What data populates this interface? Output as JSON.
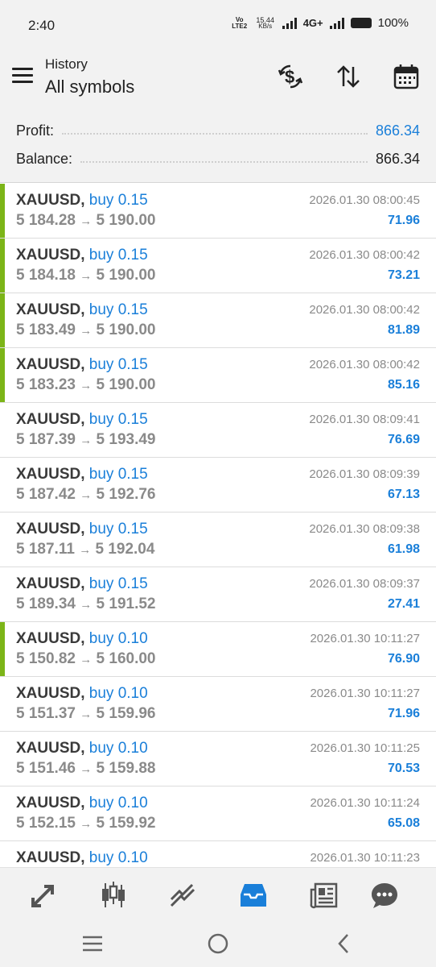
{
  "status_bar": {
    "time": "2:40",
    "volte": "Vo LTE2",
    "net_speed_value": "15.44",
    "net_speed_unit": "KB/s",
    "network": "4G+",
    "battery": "100%"
  },
  "header": {
    "subtitle": "History",
    "title": "All symbols"
  },
  "summary": {
    "profit_label": "Profit:",
    "profit_value": "866.34",
    "balance_label": "Balance:",
    "balance_value": "866.34",
    "profit_color": "#1a7fd9"
  },
  "deals": [
    {
      "symbol": "XAUUSD,",
      "direction": "buy 0.15",
      "open": "5 184.28",
      "close": "5 190.00",
      "time": "2026.01.30 08:00:45",
      "profit": "71.96",
      "marked": true
    },
    {
      "symbol": "XAUUSD,",
      "direction": "buy 0.15",
      "open": "5 184.18",
      "close": "5 190.00",
      "time": "2026.01.30 08:00:42",
      "profit": "73.21",
      "marked": true
    },
    {
      "symbol": "XAUUSD,",
      "direction": "buy 0.15",
      "open": "5 183.49",
      "close": "5 190.00",
      "time": "2026.01.30 08:00:42",
      "profit": "81.89",
      "marked": true
    },
    {
      "symbol": "XAUUSD,",
      "direction": "buy 0.15",
      "open": "5 183.23",
      "close": "5 190.00",
      "time": "2026.01.30 08:00:42",
      "profit": "85.16",
      "marked": true
    },
    {
      "symbol": "XAUUSD,",
      "direction": "buy 0.15",
      "open": "5 187.39",
      "close": "5 193.49",
      "time": "2026.01.30 08:09:41",
      "profit": "76.69",
      "marked": false
    },
    {
      "symbol": "XAUUSD,",
      "direction": "buy 0.15",
      "open": "5 187.42",
      "close": "5 192.76",
      "time": "2026.01.30 08:09:39",
      "profit": "67.13",
      "marked": false
    },
    {
      "symbol": "XAUUSD,",
      "direction": "buy 0.15",
      "open": "5 187.11",
      "close": "5 192.04",
      "time": "2026.01.30 08:09:38",
      "profit": "61.98",
      "marked": false
    },
    {
      "symbol": "XAUUSD,",
      "direction": "buy 0.15",
      "open": "5 189.34",
      "close": "5 191.52",
      "time": "2026.01.30 08:09:37",
      "profit": "27.41",
      "marked": false
    },
    {
      "symbol": "XAUUSD,",
      "direction": "buy 0.10",
      "open": "5 150.82",
      "close": "5 160.00",
      "time": "2026.01.30 10:11:27",
      "profit": "76.90",
      "marked": true
    },
    {
      "symbol": "XAUUSD,",
      "direction": "buy 0.10",
      "open": "5 151.37",
      "close": "5 159.96",
      "time": "2026.01.30 10:11:27",
      "profit": "71.96",
      "marked": false
    },
    {
      "symbol": "XAUUSD,",
      "direction": "buy 0.10",
      "open": "5 151.46",
      "close": "5 159.88",
      "time": "2026.01.30 10:11:25",
      "profit": "70.53",
      "marked": false
    },
    {
      "symbol": "XAUUSD,",
      "direction": "buy 0.10",
      "open": "5 152.15",
      "close": "5 159.92",
      "time": "2026.01.30 10:11:24",
      "profit": "65.08",
      "marked": false
    },
    {
      "symbol": "XAUUSD,",
      "direction": "buy 0.10",
      "open": "",
      "close": "",
      "time": "2026.01.30 10:11:23",
      "profit": "",
      "marked": false
    }
  ],
  "arrow": "→",
  "colors": {
    "accent": "#1a7fd9",
    "marker": "#7cb518",
    "muted": "#8a8a8a"
  },
  "bottom_nav": [
    {
      "name": "quotes-icon"
    },
    {
      "name": "chart-icon"
    },
    {
      "name": "trade-icon"
    },
    {
      "name": "history-icon",
      "active": true
    },
    {
      "name": "news-icon"
    },
    {
      "name": "messages-icon"
    }
  ],
  "header_icons": [
    "currency-exchange-icon",
    "sort-icon",
    "calendar-icon"
  ]
}
